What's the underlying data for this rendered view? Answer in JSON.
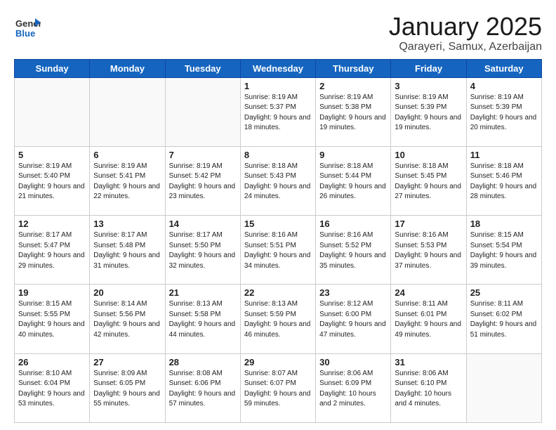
{
  "logo": {
    "general": "General",
    "blue": "Blue"
  },
  "header": {
    "title": "January 2025",
    "location": "Qarayeri, Samux, Azerbaijan"
  },
  "days_of_week": [
    "Sunday",
    "Monday",
    "Tuesday",
    "Wednesday",
    "Thursday",
    "Friday",
    "Saturday"
  ],
  "weeks": [
    [
      {
        "day": "",
        "sunrise": "",
        "sunset": "",
        "daylight": ""
      },
      {
        "day": "",
        "sunrise": "",
        "sunset": "",
        "daylight": ""
      },
      {
        "day": "",
        "sunrise": "",
        "sunset": "",
        "daylight": ""
      },
      {
        "day": "1",
        "sunrise": "Sunrise: 8:19 AM",
        "sunset": "Sunset: 5:37 PM",
        "daylight": "Daylight: 9 hours and 18 minutes."
      },
      {
        "day": "2",
        "sunrise": "Sunrise: 8:19 AM",
        "sunset": "Sunset: 5:38 PM",
        "daylight": "Daylight: 9 hours and 19 minutes."
      },
      {
        "day": "3",
        "sunrise": "Sunrise: 8:19 AM",
        "sunset": "Sunset: 5:39 PM",
        "daylight": "Daylight: 9 hours and 19 minutes."
      },
      {
        "day": "4",
        "sunrise": "Sunrise: 8:19 AM",
        "sunset": "Sunset: 5:39 PM",
        "daylight": "Daylight: 9 hours and 20 minutes."
      }
    ],
    [
      {
        "day": "5",
        "sunrise": "Sunrise: 8:19 AM",
        "sunset": "Sunset: 5:40 PM",
        "daylight": "Daylight: 9 hours and 21 minutes."
      },
      {
        "day": "6",
        "sunrise": "Sunrise: 8:19 AM",
        "sunset": "Sunset: 5:41 PM",
        "daylight": "Daylight: 9 hours and 22 minutes."
      },
      {
        "day": "7",
        "sunrise": "Sunrise: 8:19 AM",
        "sunset": "Sunset: 5:42 PM",
        "daylight": "Daylight: 9 hours and 23 minutes."
      },
      {
        "day": "8",
        "sunrise": "Sunrise: 8:18 AM",
        "sunset": "Sunset: 5:43 PM",
        "daylight": "Daylight: 9 hours and 24 minutes."
      },
      {
        "day": "9",
        "sunrise": "Sunrise: 8:18 AM",
        "sunset": "Sunset: 5:44 PM",
        "daylight": "Daylight: 9 hours and 26 minutes."
      },
      {
        "day": "10",
        "sunrise": "Sunrise: 8:18 AM",
        "sunset": "Sunset: 5:45 PM",
        "daylight": "Daylight: 9 hours and 27 minutes."
      },
      {
        "day": "11",
        "sunrise": "Sunrise: 8:18 AM",
        "sunset": "Sunset: 5:46 PM",
        "daylight": "Daylight: 9 hours and 28 minutes."
      }
    ],
    [
      {
        "day": "12",
        "sunrise": "Sunrise: 8:17 AM",
        "sunset": "Sunset: 5:47 PM",
        "daylight": "Daylight: 9 hours and 29 minutes."
      },
      {
        "day": "13",
        "sunrise": "Sunrise: 8:17 AM",
        "sunset": "Sunset: 5:48 PM",
        "daylight": "Daylight: 9 hours and 31 minutes."
      },
      {
        "day": "14",
        "sunrise": "Sunrise: 8:17 AM",
        "sunset": "Sunset: 5:50 PM",
        "daylight": "Daylight: 9 hours and 32 minutes."
      },
      {
        "day": "15",
        "sunrise": "Sunrise: 8:16 AM",
        "sunset": "Sunset: 5:51 PM",
        "daylight": "Daylight: 9 hours and 34 minutes."
      },
      {
        "day": "16",
        "sunrise": "Sunrise: 8:16 AM",
        "sunset": "Sunset: 5:52 PM",
        "daylight": "Daylight: 9 hours and 35 minutes."
      },
      {
        "day": "17",
        "sunrise": "Sunrise: 8:16 AM",
        "sunset": "Sunset: 5:53 PM",
        "daylight": "Daylight: 9 hours and 37 minutes."
      },
      {
        "day": "18",
        "sunrise": "Sunrise: 8:15 AM",
        "sunset": "Sunset: 5:54 PM",
        "daylight": "Daylight: 9 hours and 39 minutes."
      }
    ],
    [
      {
        "day": "19",
        "sunrise": "Sunrise: 8:15 AM",
        "sunset": "Sunset: 5:55 PM",
        "daylight": "Daylight: 9 hours and 40 minutes."
      },
      {
        "day": "20",
        "sunrise": "Sunrise: 8:14 AM",
        "sunset": "Sunset: 5:56 PM",
        "daylight": "Daylight: 9 hours and 42 minutes."
      },
      {
        "day": "21",
        "sunrise": "Sunrise: 8:13 AM",
        "sunset": "Sunset: 5:58 PM",
        "daylight": "Daylight: 9 hours and 44 minutes."
      },
      {
        "day": "22",
        "sunrise": "Sunrise: 8:13 AM",
        "sunset": "Sunset: 5:59 PM",
        "daylight": "Daylight: 9 hours and 46 minutes."
      },
      {
        "day": "23",
        "sunrise": "Sunrise: 8:12 AM",
        "sunset": "Sunset: 6:00 PM",
        "daylight": "Daylight: 9 hours and 47 minutes."
      },
      {
        "day": "24",
        "sunrise": "Sunrise: 8:11 AM",
        "sunset": "Sunset: 6:01 PM",
        "daylight": "Daylight: 9 hours and 49 minutes."
      },
      {
        "day": "25",
        "sunrise": "Sunrise: 8:11 AM",
        "sunset": "Sunset: 6:02 PM",
        "daylight": "Daylight: 9 hours and 51 minutes."
      }
    ],
    [
      {
        "day": "26",
        "sunrise": "Sunrise: 8:10 AM",
        "sunset": "Sunset: 6:04 PM",
        "daylight": "Daylight: 9 hours and 53 minutes."
      },
      {
        "day": "27",
        "sunrise": "Sunrise: 8:09 AM",
        "sunset": "Sunset: 6:05 PM",
        "daylight": "Daylight: 9 hours and 55 minutes."
      },
      {
        "day": "28",
        "sunrise": "Sunrise: 8:08 AM",
        "sunset": "Sunset: 6:06 PM",
        "daylight": "Daylight: 9 hours and 57 minutes."
      },
      {
        "day": "29",
        "sunrise": "Sunrise: 8:07 AM",
        "sunset": "Sunset: 6:07 PM",
        "daylight": "Daylight: 9 hours and 59 minutes."
      },
      {
        "day": "30",
        "sunrise": "Sunrise: 8:06 AM",
        "sunset": "Sunset: 6:09 PM",
        "daylight": "Daylight: 10 hours and 2 minutes."
      },
      {
        "day": "31",
        "sunrise": "Sunrise: 8:06 AM",
        "sunset": "Sunset: 6:10 PM",
        "daylight": "Daylight: 10 hours and 4 minutes."
      },
      {
        "day": "",
        "sunrise": "",
        "sunset": "",
        "daylight": ""
      }
    ]
  ]
}
